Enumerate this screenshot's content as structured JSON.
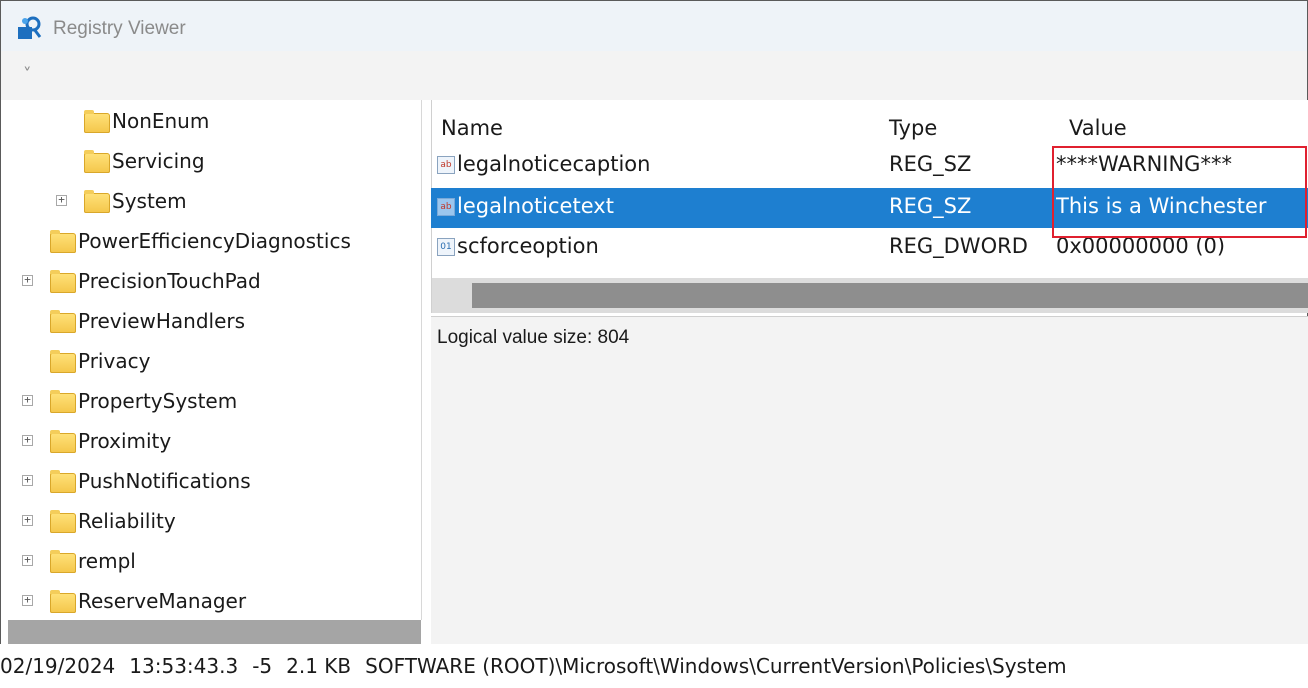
{
  "window": {
    "title": "Registry Viewer"
  },
  "menubar": {
    "chevron": "˅"
  },
  "tree": {
    "nodes": [
      {
        "label": "NonEnum",
        "expandable": false
      },
      {
        "label": "Servicing",
        "expandable": false
      },
      {
        "label": "System",
        "expandable": true
      },
      {
        "label": "PowerEfficiencyDiagnostics",
        "expandable": false
      },
      {
        "label": "PrecisionTouchPad",
        "expandable": true
      },
      {
        "label": "PreviewHandlers",
        "expandable": false
      },
      {
        "label": "Privacy",
        "expandable": false
      },
      {
        "label": "PropertySystem",
        "expandable": true
      },
      {
        "label": "Proximity",
        "expandable": true
      },
      {
        "label": "PushNotifications",
        "expandable": true
      },
      {
        "label": "Reliability",
        "expandable": true
      },
      {
        "label": "rempl",
        "expandable": true
      },
      {
        "label": "ReserveManager",
        "expandable": true
      }
    ]
  },
  "values_table": {
    "columns": {
      "name": "Name",
      "type": "Type",
      "value": "Value"
    },
    "rows": [
      {
        "name": "legalnoticecaption",
        "type": "REG_SZ",
        "value": "****WARNING***",
        "icon": "string-value-icon",
        "selected": false
      },
      {
        "name": "legalnoticetext",
        "type": "REG_SZ",
        "value": "This is a Winchester",
        "icon": "string-value-icon",
        "selected": true
      },
      {
        "name": "scforceoption",
        "type": "REG_DWORD",
        "value": "0x00000000 (0)",
        "icon": "dword-value-icon",
        "selected": false
      }
    ]
  },
  "info": {
    "logical_value_size": "Logical value size: 804"
  },
  "status": {
    "date": "02/19/2024",
    "time": "13:53:43.3",
    "offset": "-5",
    "size": "2.1 KB",
    "path": "SOFTWARE (ROOT)\\Microsoft\\Windows\\CurrentVersion\\Policies\\System"
  },
  "colors": {
    "selection": "#1e7fd0",
    "highlight_border": "#e0202f",
    "folder": "#f4c64a"
  }
}
